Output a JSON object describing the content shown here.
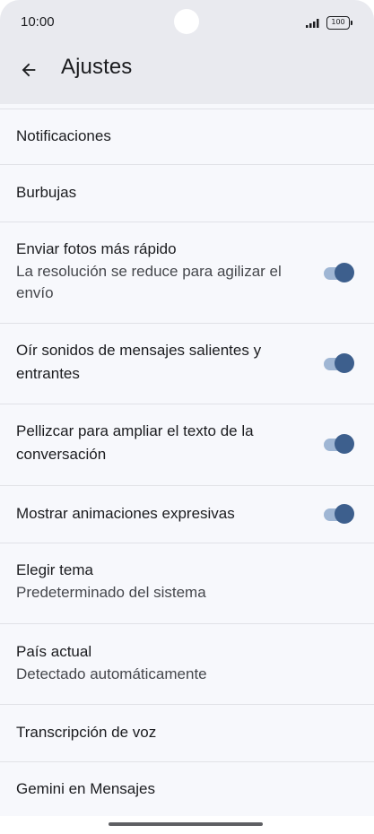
{
  "status_bar": {
    "time": "10:00",
    "battery": "100"
  },
  "header": {
    "title": "Ajustes",
    "back_icon": "arrow-back-icon"
  },
  "settings": [
    {
      "title": "Notificaciones"
    },
    {
      "title": "Burbujas"
    },
    {
      "title": "Enviar fotos más rápido",
      "subtitle": "La resolución se reduce para agilizar el envío",
      "toggle": true
    },
    {
      "title": "Oír sonidos de mensajes salientes y entrantes",
      "toggle": true
    },
    {
      "title": "Pellizcar para ampliar el texto de la conversación",
      "toggle": true
    },
    {
      "title": "Mostrar animaciones expresivas",
      "toggle": true
    },
    {
      "title": "Elegir tema",
      "subtitle": "Predeterminado del sistema"
    },
    {
      "title": "País actual",
      "subtitle": "Detectado automáticamente"
    },
    {
      "title": "Transcripción de voz"
    },
    {
      "title": "Gemini en Mensajes"
    }
  ],
  "colors": {
    "toggle_thumb": "#3d5f8d",
    "toggle_track": "#9fb6d4",
    "header_bg": "#e9eaef",
    "background": "#f7f8fc"
  }
}
